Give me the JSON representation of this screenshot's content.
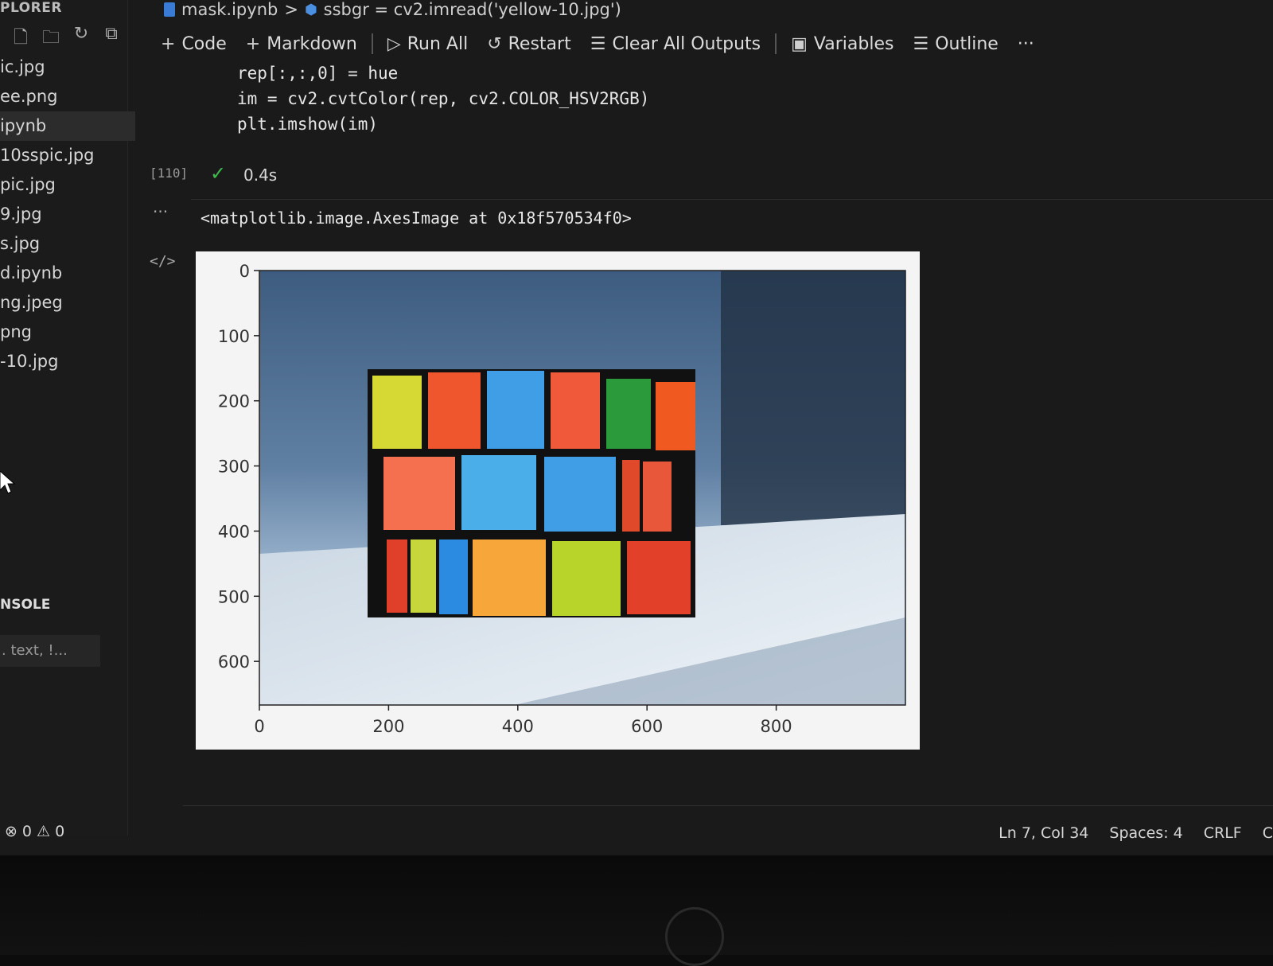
{
  "sidebar": {
    "title": "PLORER",
    "files": [
      "ic.jpg",
      "ee.png",
      "ipynb",
      "10sspic.jpg",
      "pic.jpg",
      "9.jpg",
      "s.jpg",
      "d.ipynb",
      "ng.jpeg",
      "png",
      "-10.jpg"
    ],
    "active_index": 2,
    "section_label": "NSOLE",
    "filter_placeholder": ". text, !..."
  },
  "breadcrumb": {
    "file": "mask.ipynb",
    "separator": ">",
    "cell": "ssbgr = cv2.imread('yellow-10.jpg')"
  },
  "toolbar": {
    "code": "Code",
    "markdown": "Markdown",
    "run_all": "Run All",
    "restart": "Restart",
    "clear_outputs": "Clear All Outputs",
    "variables": "Variables",
    "outline": "Outline",
    "more": "···"
  },
  "cell": {
    "lines": [
      "rep[:,:,0] = hue",
      "im = cv2.cvtColor(rep, cv2.COLOR_HSV2RGB)",
      "plt.imshow(im)"
    ],
    "execution_count": "[110]",
    "exec_time": "0.4s",
    "output_text": "<matplotlib.image.AxesImage at 0x18f570534f0>",
    "output_dots": "···",
    "code_toggle": "</>"
  },
  "chart_data": {
    "type": "image",
    "xticks": [
      "0",
      "200",
      "400",
      "600",
      "800"
    ],
    "yticks": [
      "0",
      "100",
      "200",
      "300",
      "400",
      "500",
      "600"
    ],
    "xlim": [
      0,
      1000
    ],
    "ylim": [
      667,
      0
    ]
  },
  "status": {
    "errors": "0",
    "warnings": "0",
    "position": "Ln 7, Col 34",
    "spaces": "Spaces: 4",
    "eol": "CRLF",
    "extra": "C"
  },
  "colors": {
    "accent_blue": "#3a7bd5",
    "success_green": "#3fb950",
    "code_yellow": "#f2c94c"
  }
}
